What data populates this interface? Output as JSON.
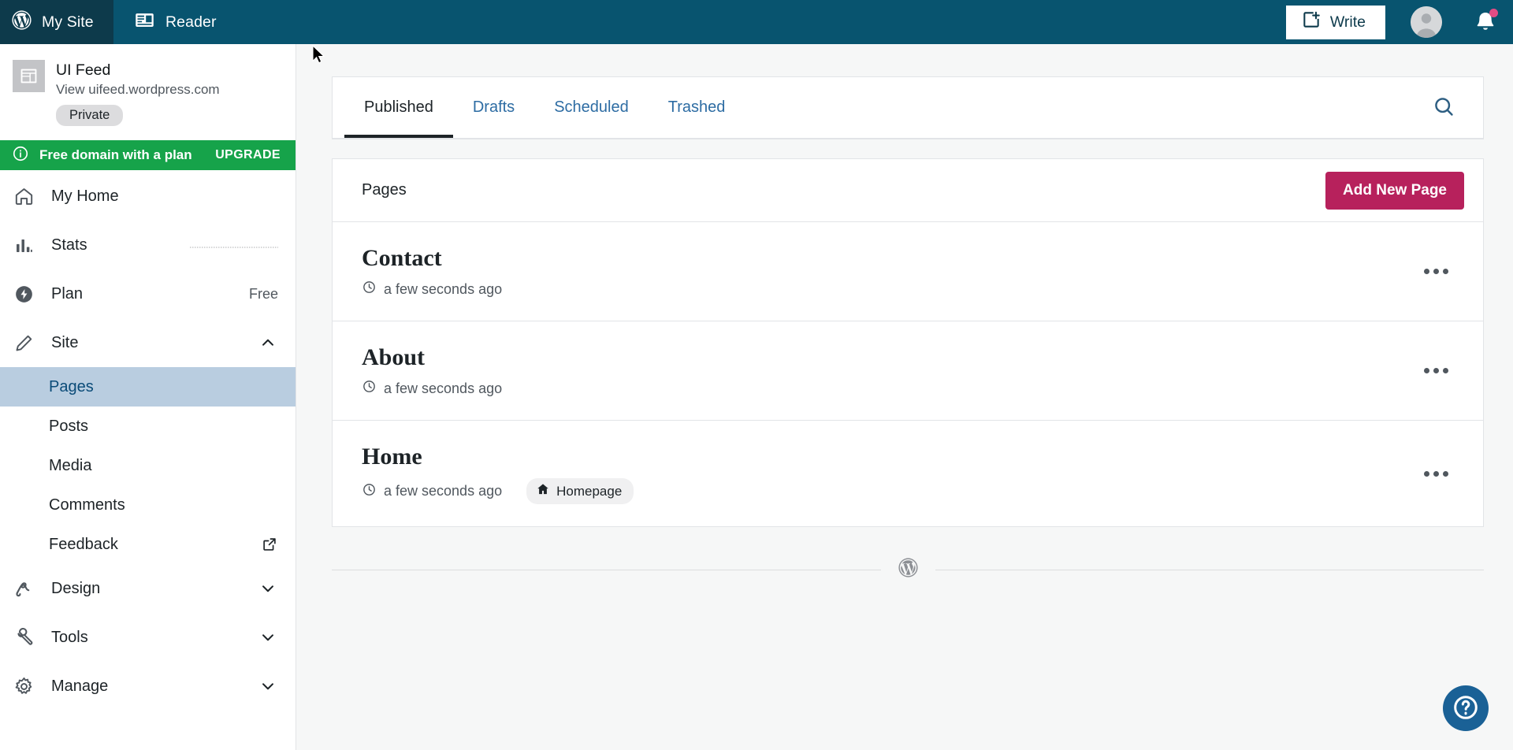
{
  "masthead": {
    "my_site_label": "My Site",
    "reader_label": "Reader",
    "write_label": "Write",
    "my_site_icon": "wordpress-logo-icon",
    "reader_icon": "reader-icon",
    "write_icon": "write-new-icon",
    "avatar_icon": "user-avatar-icon",
    "notifications_icon": "notifications-bell-icon",
    "colors": {
      "dark": "#0d3a4b",
      "teal": "#08546f"
    }
  },
  "sidebar": {
    "site": {
      "title": "UI Feed",
      "url": "View uifeed.wordpress.com",
      "visibility_badge": "Private",
      "thumb_icon": "site-preview-icon"
    },
    "upgrade_banner": {
      "icon": "info-circle-icon",
      "text": "Free domain with a plan",
      "action": "UPGRADE",
      "color": "#16a34a"
    },
    "items": [
      {
        "label": "My Home",
        "icon": "home-icon",
        "value": "",
        "type": "link"
      },
      {
        "label": "Stats",
        "icon": "stats-bars-icon",
        "value": "",
        "type": "link"
      },
      {
        "label": "Plan",
        "icon": "plan-bolt-icon",
        "value": "Free",
        "type": "link"
      },
      {
        "label": "Site",
        "icon": "pencil-icon",
        "value": "",
        "type": "expanded-group"
      },
      {
        "label": "Design",
        "icon": "design-brush-icon",
        "value": "",
        "type": "collapsed-group"
      },
      {
        "label": "Tools",
        "icon": "tools-wrench-icon",
        "value": "",
        "type": "collapsed-group"
      },
      {
        "label": "Manage",
        "icon": "gear-icon",
        "value": "",
        "type": "collapsed-group"
      }
    ],
    "site_subitems": [
      {
        "label": "Pages",
        "active": true,
        "external": false
      },
      {
        "label": "Posts",
        "active": false,
        "external": false
      },
      {
        "label": "Media",
        "active": false,
        "external": false
      },
      {
        "label": "Comments",
        "active": false,
        "external": false
      },
      {
        "label": "Feedback",
        "active": false,
        "external": true
      }
    ]
  },
  "main": {
    "tabs": [
      {
        "label": "Published",
        "active": true
      },
      {
        "label": "Drafts",
        "active": false
      },
      {
        "label": "Scheduled",
        "active": false
      },
      {
        "label": "Trashed",
        "active": false
      }
    ],
    "search_icon": "search-icon",
    "list_title": "Pages",
    "add_button": "Add New Page",
    "add_button_color": "#b7215c",
    "pages": [
      {
        "title": "Contact",
        "time": "a few seconds ago",
        "badge": null
      },
      {
        "title": "About",
        "time": "a few seconds ago",
        "badge": null
      },
      {
        "title": "Home",
        "time": "a few seconds ago",
        "badge": "Homepage"
      }
    ],
    "clock_icon": "clock-icon",
    "homepage_icon": "home-icon",
    "more_icon": "ellipsis-horizontal-icon",
    "divider_icon": "wordpress-logo-icon",
    "help_icon": "help-question-icon"
  }
}
